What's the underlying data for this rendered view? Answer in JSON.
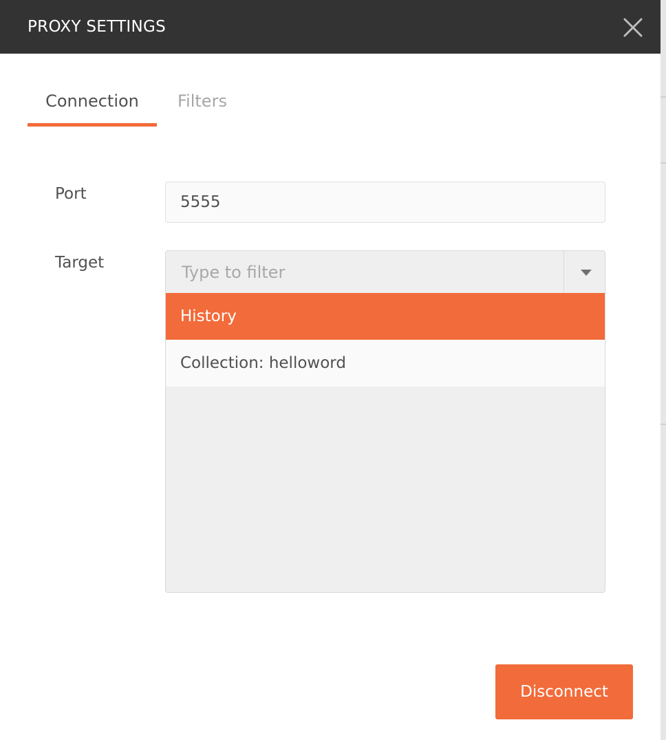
{
  "dialog": {
    "title": "PROXY SETTINGS",
    "close_icon": "close-icon"
  },
  "tabs": [
    {
      "label": "Connection",
      "active": true
    },
    {
      "label": "Filters",
      "active": false
    }
  ],
  "form": {
    "port": {
      "label": "Port",
      "value": "5555"
    },
    "target": {
      "label": "Target",
      "filter_placeholder": "Type to filter",
      "toggle_icon": "caret-down-icon",
      "options": [
        {
          "label": "History",
          "selected": true
        },
        {
          "label": "Collection: helloword",
          "selected": false
        }
      ]
    }
  },
  "actions": {
    "disconnect_label": "Disconnect"
  },
  "colors": {
    "accent": "#f26b3a",
    "titlebar": "#333333"
  }
}
